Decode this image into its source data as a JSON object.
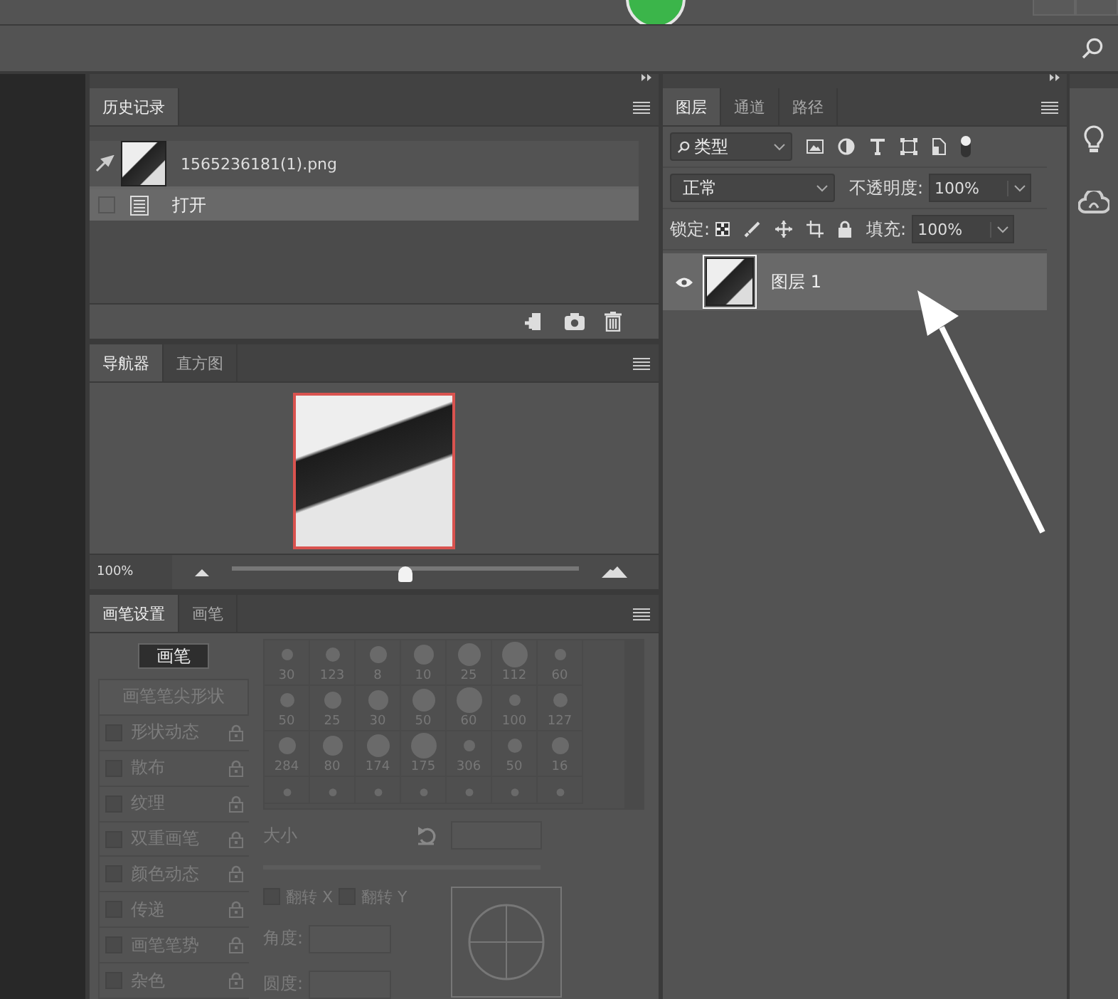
{
  "history": {
    "tabs": [
      {
        "label": "历史记录",
        "selected": true
      }
    ],
    "snapshot": {
      "label": "1565236181(1).png"
    },
    "states": [
      {
        "label": "打开",
        "selected": true
      }
    ]
  },
  "navigator": {
    "tabs": [
      {
        "label": "导航器",
        "selected": true
      },
      {
        "label": "直方图",
        "selected": false
      }
    ],
    "zoom": "100%",
    "level": 0.5
  },
  "brush_settings": {
    "tabs": [
      {
        "label": "画笔设置",
        "selected": true
      },
      {
        "label": "画笔",
        "selected": false
      }
    ],
    "brushes_button": "画笔",
    "tip_shape": "画笔笔尖形状",
    "options": [
      {
        "label": "形状动态",
        "checked": false
      },
      {
        "label": "散布",
        "checked": false
      },
      {
        "label": "纹理",
        "checked": false
      },
      {
        "label": "双重画笔",
        "checked": false
      },
      {
        "label": "颜色动态",
        "checked": false
      },
      {
        "label": "传递",
        "checked": false
      },
      {
        "label": "画笔笔势",
        "checked": false
      },
      {
        "label": "杂色",
        "checked": false
      }
    ],
    "presets": [
      "30",
      "123",
      "8",
      "10",
      "25",
      "112",
      "60",
      "50",
      "25",
      "30",
      "50",
      "60",
      "100",
      "127",
      "284",
      "80",
      "174",
      "175",
      "306",
      "50",
      "16"
    ],
    "size_label": "大小",
    "flip": [
      {
        "label": "翻转 X",
        "checked": false
      },
      {
        "label": "翻转 Y",
        "checked": false
      }
    ],
    "angle_label": "角度:",
    "roundness_label": "圆度:"
  },
  "layers": {
    "tabs": [
      {
        "label": "图层",
        "selected": true
      },
      {
        "label": "通道",
        "selected": false
      },
      {
        "label": "路径",
        "selected": false
      }
    ],
    "filter": "类型",
    "blend_mode": "正常",
    "opacity_label": "不透明度:",
    "opacity": "100%",
    "lock_label": "锁定:",
    "fill_label": "填充:",
    "fill": "100%",
    "items": [
      {
        "name": "图层 1",
        "visible": true,
        "selected": true
      }
    ]
  }
}
